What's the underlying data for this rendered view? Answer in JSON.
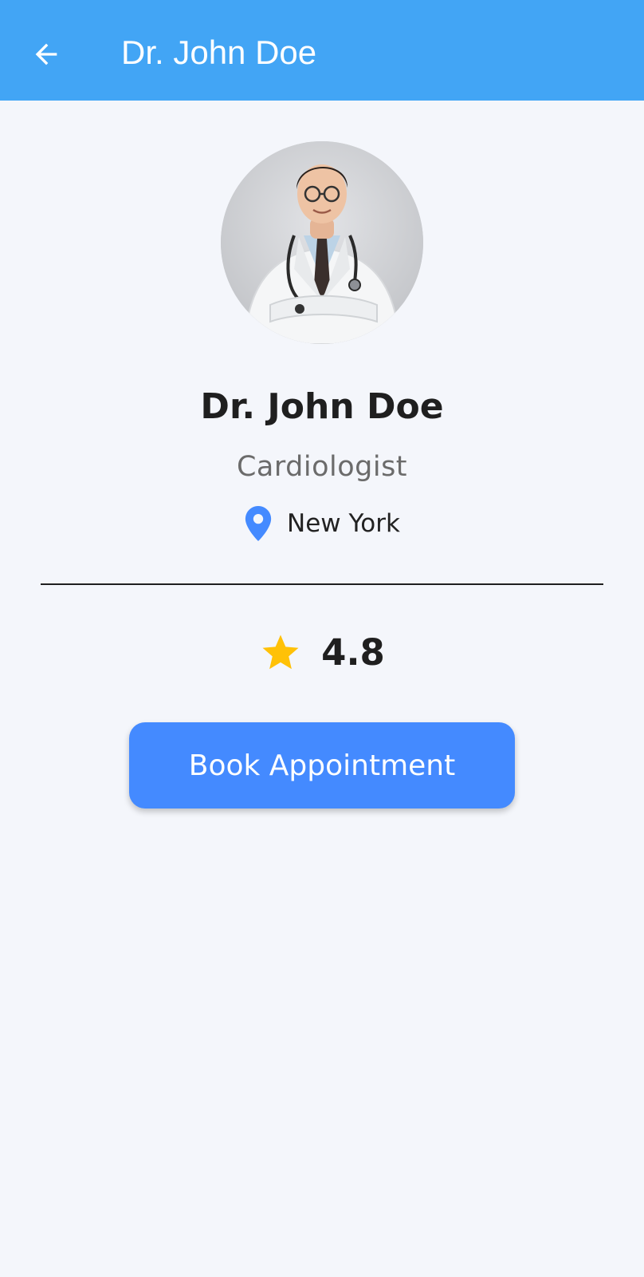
{
  "app_bar": {
    "title": "Dr. John Doe",
    "back_icon": "arrow-back-icon",
    "background_color": "#42a5f5"
  },
  "profile": {
    "name": "Dr. John Doe",
    "specialty": "Cardiologist",
    "location_icon": "location-pin-icon",
    "location": "New York",
    "rating_icon": "star-icon",
    "rating": "4.8"
  },
  "actions": {
    "book_label": "Book Appointment"
  },
  "colors": {
    "accent": "#448aff",
    "star": "#ffc107",
    "pin": "#448aff",
    "background": "#f4f6fb"
  }
}
